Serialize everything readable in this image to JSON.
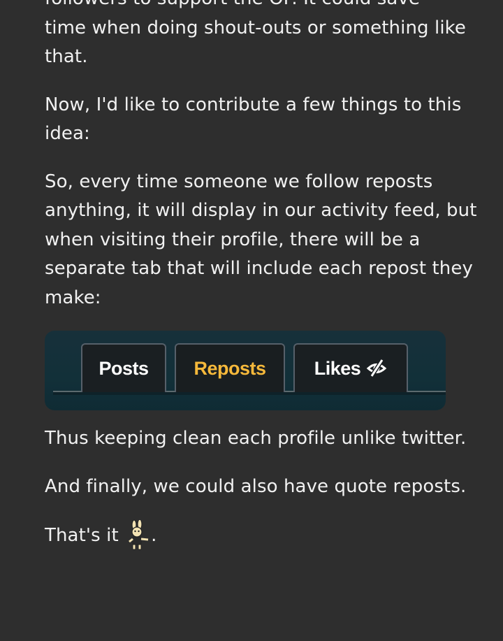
{
  "post": {
    "paragraph_0_cut": "followers to support the OP. It could save",
    "paragraph_0_rest": "time when doing shout-outs or something like that.",
    "paragraph_1": "Now, I'd like to contribute a few things to this idea:",
    "paragraph_2": "So, every time someone we follow reposts anything, it will display in our activity feed, but when visiting their profile, there will be a separate tab that will include each repost they make:",
    "paragraph_3": "Thus keeping clean each profile unlike twitter.",
    "paragraph_4": "And finally, we could also have quote reposts.",
    "paragraph_5_text": "That's it",
    "paragraph_5_end": "."
  },
  "tabs_image": {
    "tabs": [
      "Posts",
      "Reposts",
      "Likes"
    ],
    "active_tab": "Reposts",
    "active_color": "#f6b93b",
    "likes_icon": "eye-slash-icon"
  },
  "emoji": "bunny-pointing-emoji"
}
